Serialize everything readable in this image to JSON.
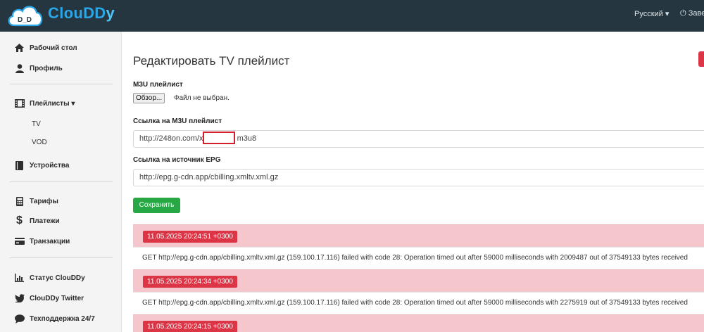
{
  "brand": {
    "logo_text": "D_D",
    "name": "ClouDD",
    "name_end": "y"
  },
  "navbar": {
    "language": "Русский ▾",
    "logout": "Заве"
  },
  "sidebar": {
    "items": [
      {
        "label": "Рабочий стол",
        "icon": "home-icon"
      },
      {
        "label": "Профиль",
        "icon": "user-icon"
      },
      {
        "label": "Плейлисты ▾",
        "icon": "film-icon"
      },
      {
        "label": "Устройства",
        "icon": "book-icon"
      },
      {
        "label": "Тарифы",
        "icon": "calculator-icon"
      },
      {
        "label": "Платежи",
        "icon": "dollar-icon"
      },
      {
        "label": "Транзакции",
        "icon": "credit-card-icon"
      },
      {
        "label": "Статус ClouDDy",
        "icon": "bar-chart-icon"
      },
      {
        "label": "ClouDDy Twitter",
        "icon": "twitter-icon"
      },
      {
        "label": "Техподдержка 24/7",
        "icon": "chat-icon"
      }
    ],
    "subitems": [
      {
        "label": "TV"
      },
      {
        "label": "VOD"
      }
    ]
  },
  "form": {
    "title": "Редактировать TV плейлист",
    "m3u_label": "M3U плейлист",
    "file_button": "Обзор...",
    "file_status": "Файл не выбран.",
    "url_label": "Ссылка на M3U плейлист",
    "url_value_start": "http://248on.com/x/",
    "url_value_end": "m3u8",
    "epg_label": "Ссылка на источник EPG",
    "epg_value": "http://epg.g-cdn.app/cbilling.xmltv.xml.gz",
    "save_button": "Сохранить"
  },
  "logs": [
    {
      "timestamp": "11.05.2025 20:24:51 +0300",
      "message": "GET http://epg.g-cdn.app/cbilling.xmltv.xml.gz (159.100.17.116) failed with code 28: Operation timed out after 59000 milliseconds with 2009487 out of 37549133 bytes received"
    },
    {
      "timestamp": "11.05.2025 20:24:34 +0300",
      "message": "GET http://epg.g-cdn.app/cbilling.xmltv.xml.gz (159.100.17.116) failed with code 28: Operation timed out after 59000 milliseconds with 2275919 out of 37549133 bytes received"
    },
    {
      "timestamp": "11.05.2025 20:24:15 +0300",
      "message": ""
    }
  ],
  "colors": {
    "navbar": "#253641",
    "brand": "#2aa6e6",
    "save": "#28a745",
    "danger": "#dc3545",
    "log_bg": "#f5c6cb"
  }
}
